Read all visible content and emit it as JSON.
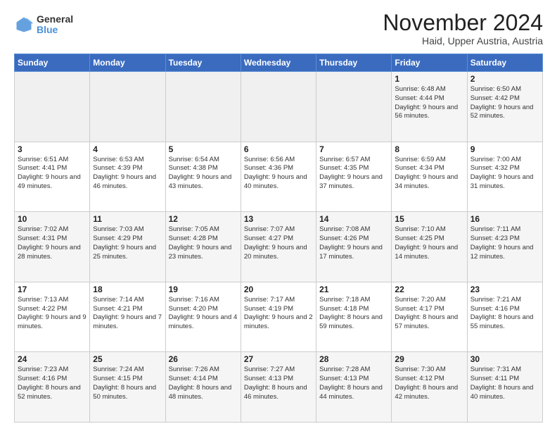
{
  "logo": {
    "line1": "General",
    "line2": "Blue"
  },
  "title": "November 2024",
  "subtitle": "Haid, Upper Austria, Austria",
  "days_of_week": [
    "Sunday",
    "Monday",
    "Tuesday",
    "Wednesday",
    "Thursday",
    "Friday",
    "Saturday"
  ],
  "weeks": [
    [
      {
        "day": "",
        "info": ""
      },
      {
        "day": "",
        "info": ""
      },
      {
        "day": "",
        "info": ""
      },
      {
        "day": "",
        "info": ""
      },
      {
        "day": "",
        "info": ""
      },
      {
        "day": "1",
        "info": "Sunrise: 6:48 AM\nSunset: 4:44 PM\nDaylight: 9 hours and 56 minutes."
      },
      {
        "day": "2",
        "info": "Sunrise: 6:50 AM\nSunset: 4:42 PM\nDaylight: 9 hours and 52 minutes."
      }
    ],
    [
      {
        "day": "3",
        "info": "Sunrise: 6:51 AM\nSunset: 4:41 PM\nDaylight: 9 hours and 49 minutes."
      },
      {
        "day": "4",
        "info": "Sunrise: 6:53 AM\nSunset: 4:39 PM\nDaylight: 9 hours and 46 minutes."
      },
      {
        "day": "5",
        "info": "Sunrise: 6:54 AM\nSunset: 4:38 PM\nDaylight: 9 hours and 43 minutes."
      },
      {
        "day": "6",
        "info": "Sunrise: 6:56 AM\nSunset: 4:36 PM\nDaylight: 9 hours and 40 minutes."
      },
      {
        "day": "7",
        "info": "Sunrise: 6:57 AM\nSunset: 4:35 PM\nDaylight: 9 hours and 37 minutes."
      },
      {
        "day": "8",
        "info": "Sunrise: 6:59 AM\nSunset: 4:34 PM\nDaylight: 9 hours and 34 minutes."
      },
      {
        "day": "9",
        "info": "Sunrise: 7:00 AM\nSunset: 4:32 PM\nDaylight: 9 hours and 31 minutes."
      }
    ],
    [
      {
        "day": "10",
        "info": "Sunrise: 7:02 AM\nSunset: 4:31 PM\nDaylight: 9 hours and 28 minutes."
      },
      {
        "day": "11",
        "info": "Sunrise: 7:03 AM\nSunset: 4:29 PM\nDaylight: 9 hours and 25 minutes."
      },
      {
        "day": "12",
        "info": "Sunrise: 7:05 AM\nSunset: 4:28 PM\nDaylight: 9 hours and 23 minutes."
      },
      {
        "day": "13",
        "info": "Sunrise: 7:07 AM\nSunset: 4:27 PM\nDaylight: 9 hours and 20 minutes."
      },
      {
        "day": "14",
        "info": "Sunrise: 7:08 AM\nSunset: 4:26 PM\nDaylight: 9 hours and 17 minutes."
      },
      {
        "day": "15",
        "info": "Sunrise: 7:10 AM\nSunset: 4:25 PM\nDaylight: 9 hours and 14 minutes."
      },
      {
        "day": "16",
        "info": "Sunrise: 7:11 AM\nSunset: 4:23 PM\nDaylight: 9 hours and 12 minutes."
      }
    ],
    [
      {
        "day": "17",
        "info": "Sunrise: 7:13 AM\nSunset: 4:22 PM\nDaylight: 9 hours and 9 minutes."
      },
      {
        "day": "18",
        "info": "Sunrise: 7:14 AM\nSunset: 4:21 PM\nDaylight: 9 hours and 7 minutes."
      },
      {
        "day": "19",
        "info": "Sunrise: 7:16 AM\nSunset: 4:20 PM\nDaylight: 9 hours and 4 minutes."
      },
      {
        "day": "20",
        "info": "Sunrise: 7:17 AM\nSunset: 4:19 PM\nDaylight: 9 hours and 2 minutes."
      },
      {
        "day": "21",
        "info": "Sunrise: 7:18 AM\nSunset: 4:18 PM\nDaylight: 8 hours and 59 minutes."
      },
      {
        "day": "22",
        "info": "Sunrise: 7:20 AM\nSunset: 4:17 PM\nDaylight: 8 hours and 57 minutes."
      },
      {
        "day": "23",
        "info": "Sunrise: 7:21 AM\nSunset: 4:16 PM\nDaylight: 8 hours and 55 minutes."
      }
    ],
    [
      {
        "day": "24",
        "info": "Sunrise: 7:23 AM\nSunset: 4:16 PM\nDaylight: 8 hours and 52 minutes."
      },
      {
        "day": "25",
        "info": "Sunrise: 7:24 AM\nSunset: 4:15 PM\nDaylight: 8 hours and 50 minutes."
      },
      {
        "day": "26",
        "info": "Sunrise: 7:26 AM\nSunset: 4:14 PM\nDaylight: 8 hours and 48 minutes."
      },
      {
        "day": "27",
        "info": "Sunrise: 7:27 AM\nSunset: 4:13 PM\nDaylight: 8 hours and 46 minutes."
      },
      {
        "day": "28",
        "info": "Sunrise: 7:28 AM\nSunset: 4:13 PM\nDaylight: 8 hours and 44 minutes."
      },
      {
        "day": "29",
        "info": "Sunrise: 7:30 AM\nSunset: 4:12 PM\nDaylight: 8 hours and 42 minutes."
      },
      {
        "day": "30",
        "info": "Sunrise: 7:31 AM\nSunset: 4:11 PM\nDaylight: 8 hours and 40 minutes."
      }
    ]
  ]
}
